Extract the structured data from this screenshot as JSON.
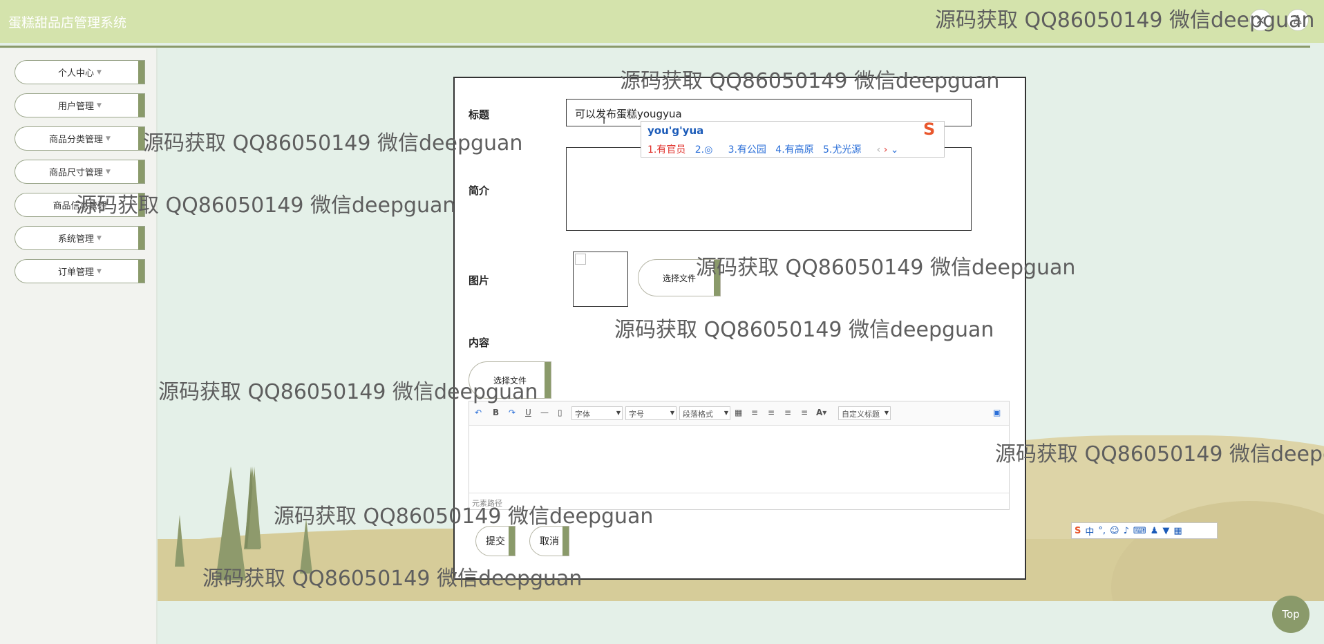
{
  "app": {
    "title": "蛋糕甜品店管理系统"
  },
  "header": {
    "close_icon": "×",
    "user_icon": "♙"
  },
  "sidebar": {
    "items": [
      {
        "label": "个人中心"
      },
      {
        "label": "用户管理"
      },
      {
        "label": "商品分类管理"
      },
      {
        "label": "商品尺寸管理"
      },
      {
        "label": "商品信息管理"
      },
      {
        "label": "系统管理"
      },
      {
        "label": "订单管理"
      }
    ]
  },
  "form": {
    "title_label": "标题",
    "title_value": "可以发布蛋糕yougyua",
    "intro_label": "简介",
    "image_label": "图片",
    "image_button": "选择文件",
    "content_label": "内容",
    "content_button": "选择文件",
    "submit": "提交",
    "cancel": "取消"
  },
  "editor": {
    "font": "字体",
    "size": "字号",
    "paragraph": "段落格式",
    "custom_title": "自定义标题",
    "footer": "元素路径"
  },
  "ime": {
    "input": "you'g'yua",
    "c1": "1.有官员",
    "c2": "2.",
    "c3": "3.有公园",
    "c4": "4.有高原",
    "c5": "5.尤光源",
    "bar_text": "中"
  },
  "top_button": "Top",
  "watermark": "源码获取 QQ86050149 微信deepguan",
  "colors": {
    "accent": "#8a9a6a",
    "header": "#d4e3ac",
    "background": "#e4f0e8"
  }
}
